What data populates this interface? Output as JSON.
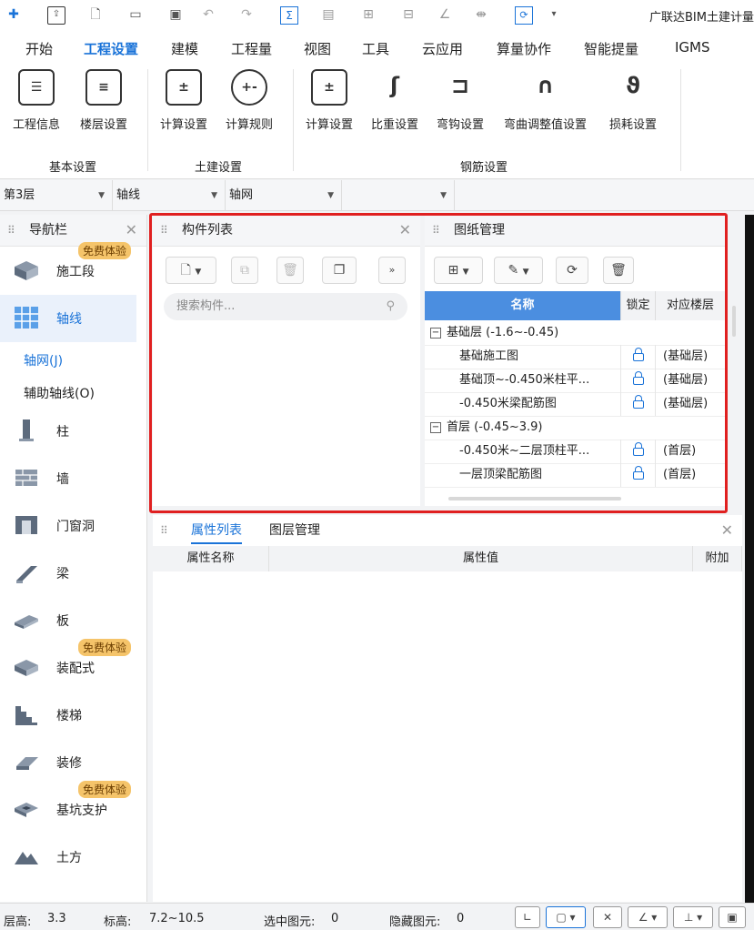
{
  "app": {
    "title": "广联达BIM土建计量"
  },
  "menu": {
    "tabs": [
      "开始",
      "工程设置",
      "建模",
      "工程量",
      "视图",
      "工具",
      "云应用",
      "算量协作",
      "智能提量",
      "IGMS"
    ],
    "active": "工程设置"
  },
  "ribbon": {
    "groups": [
      {
        "label": "基本设置",
        "buttons": [
          {
            "label": "工程信息",
            "icon": "project-info-icon"
          },
          {
            "label": "楼层设置",
            "icon": "floor-settings-icon"
          }
        ]
      },
      {
        "label": "土建设置",
        "buttons": [
          {
            "label": "计算设置",
            "icon": "calc-settings-icon"
          },
          {
            "label": "计算规则",
            "icon": "calc-rules-icon"
          }
        ]
      },
      {
        "label": "钢筋设置",
        "buttons": [
          {
            "label": "计算设置",
            "icon": "rebar-calc-settings-icon"
          },
          {
            "label": "比重设置",
            "icon": "density-settings-icon"
          },
          {
            "label": "弯钩设置",
            "icon": "hook-settings-icon"
          },
          {
            "label": "弯曲调整值设置",
            "icon": "bend-adjust-icon"
          },
          {
            "label": "损耗设置",
            "icon": "loss-settings-icon"
          }
        ]
      }
    ]
  },
  "combos": {
    "floor": "第3层",
    "category": "轴线",
    "element": "轴网",
    "extra": ""
  },
  "nav": {
    "title": "导航栏",
    "items": [
      {
        "label": "施工段",
        "badge": "免费体验",
        "icon": "construction-segment-icon"
      },
      {
        "label": "轴线",
        "icon": "grid-axis-icon"
      },
      {
        "label": "柱",
        "icon": "column-icon"
      },
      {
        "label": "墙",
        "icon": "wall-icon"
      },
      {
        "label": "门窗洞",
        "icon": "door-window-icon"
      },
      {
        "label": "梁",
        "icon": "beam-icon"
      },
      {
        "label": "板",
        "icon": "slab-icon"
      },
      {
        "label": "装配式",
        "badge": "免费体验",
        "icon": "prefab-icon"
      },
      {
        "label": "楼梯",
        "icon": "stair-icon"
      },
      {
        "label": "装修",
        "icon": "decoration-icon"
      },
      {
        "label": "基坑支护",
        "badge": "免费体验",
        "icon": "foundation-pit-icon"
      },
      {
        "label": "土方",
        "icon": "earthwork-icon"
      }
    ],
    "subitems": [
      "轴网(J)",
      "辅助轴线(O)"
    ]
  },
  "component_list": {
    "title": "构件列表",
    "search_placeholder": "搜索构件..."
  },
  "drawing_mgmt": {
    "title": "图纸管理",
    "columns": [
      "名称",
      "锁定",
      "对应楼层"
    ],
    "groups": [
      {
        "label": "基础层 (-1.6~-0.45)",
        "rows": [
          {
            "name": "基础施工图",
            "floor": "(基础层)"
          },
          {
            "name": "基础顶~-0.450米柱平...",
            "floor": "(基础层)"
          },
          {
            "name": "-0.450米梁配筋图",
            "floor": "(基础层)"
          }
        ]
      },
      {
        "label": "首层 (-0.45~3.9)",
        "rows": [
          {
            "name": "-0.450米~二层顶柱平...",
            "floor": "(首层)"
          },
          {
            "name": "一层顶梁配筋图",
            "floor": "(首层)"
          }
        ]
      }
    ]
  },
  "properties": {
    "tabs": [
      "属性列表",
      "图层管理"
    ],
    "columns": [
      "属性名称",
      "属性值",
      "附加"
    ]
  },
  "status": {
    "floor_height_label": "层高:",
    "floor_height": "3.3",
    "elevation_label": "标高:",
    "elevation": "7.2~10.5",
    "selected_label": "选中图元:",
    "selected": "0",
    "hidden_label": "隐藏图元:",
    "hidden": "0"
  },
  "colors": {
    "accent": "#1a73d8",
    "highlight": "#e02020",
    "badge": "#f5c46a"
  }
}
